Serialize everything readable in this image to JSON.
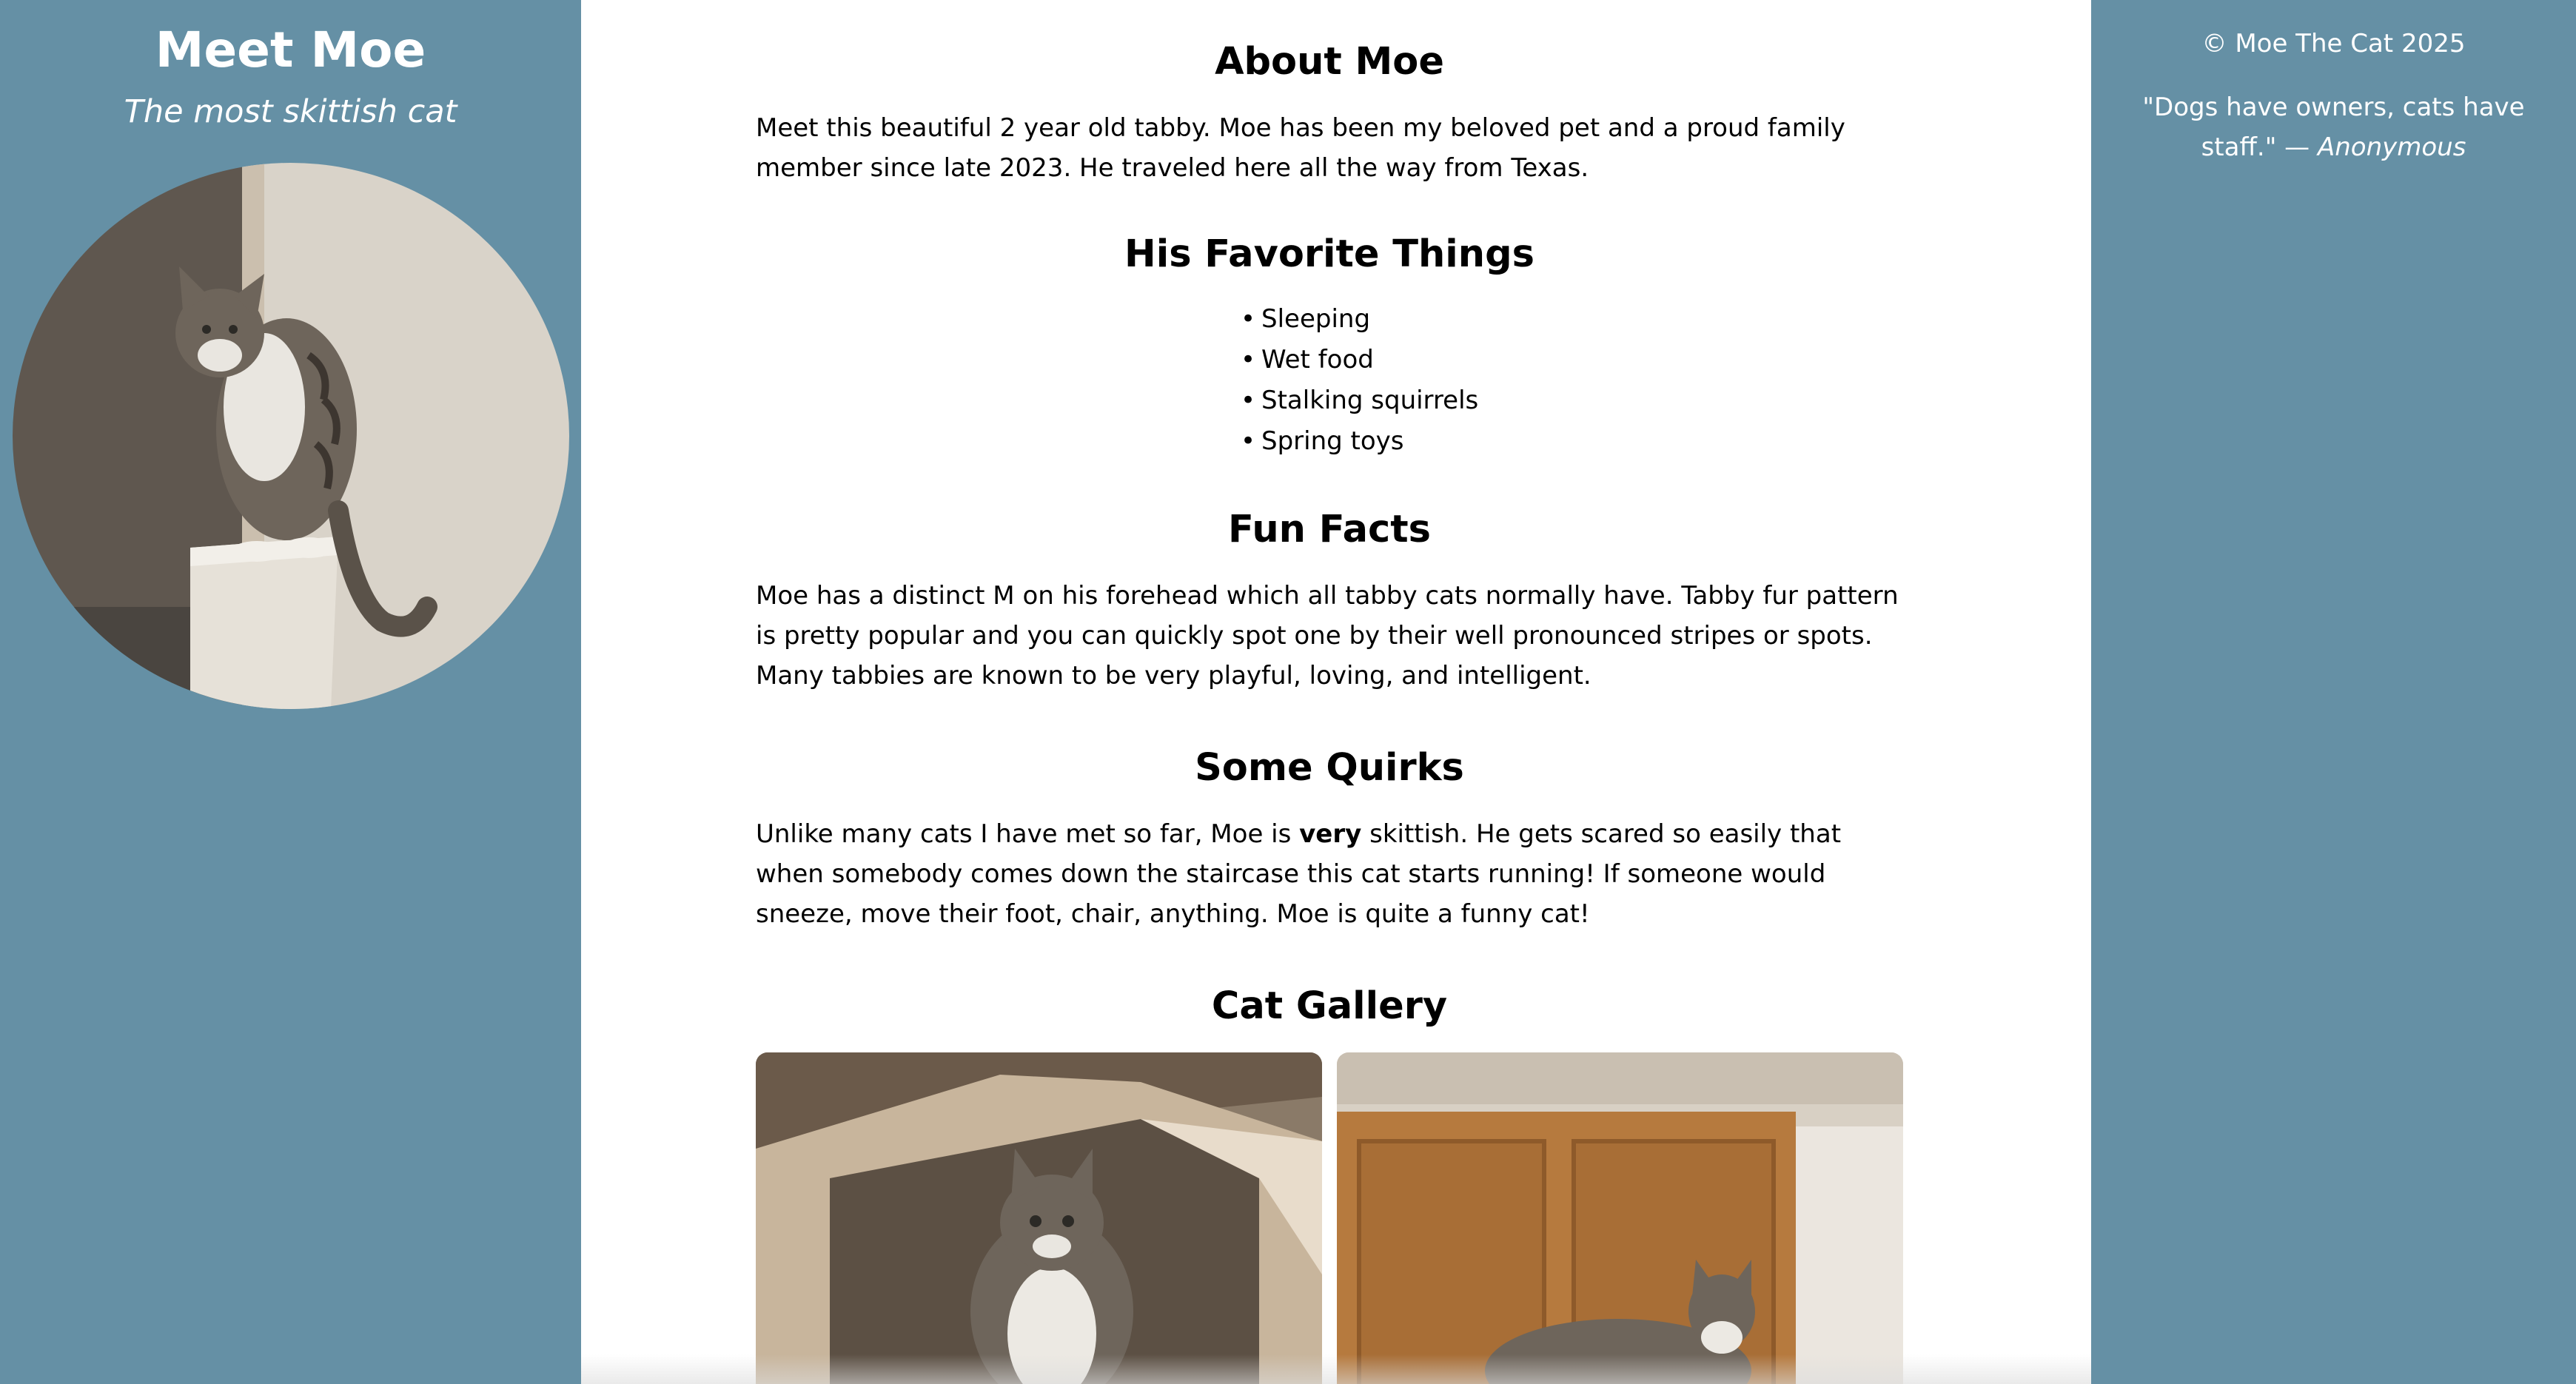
{
  "left_sidebar": {
    "title": "Meet Moe",
    "subtitle": "The most skittish cat"
  },
  "main": {
    "about": {
      "heading": "About Moe",
      "text": "Meet this beautiful 2 year old tabby. Moe has been my beloved pet and a proud family member since late 2023. He traveled here all the way from Texas."
    },
    "favorites": {
      "heading": "His Favorite Things",
      "items": [
        "Sleeping",
        "Wet food",
        "Stalking squirrels",
        "Spring toys"
      ]
    },
    "fun_facts": {
      "heading": "Fun Facts",
      "text": "Moe has a distinct M on his forehead which all tabby cats normally have. Tabby fur pattern is pretty popular and you can quickly spot one by their well pronounced stripes or spots. Many tabbies are known to be very playful, loving, and intelligent."
    },
    "quirks": {
      "heading": "Some Quirks",
      "text_before": "Unlike many cats I have met so far, Moe is ",
      "text_bold": "very",
      "text_after": " skittish. He gets scared so easily that when somebody comes down the staircase this cat starts running! If someone would sneeze, move their foot, chair, anything. Moe is quite a funny cat!"
    },
    "gallery": {
      "heading": "Cat Gallery"
    }
  },
  "right_sidebar": {
    "copyright": "© Moe The Cat 2025",
    "quote": "\"Dogs have owners, cats have staff.\" — ",
    "quote_author": "Anonymous"
  },
  "colors": {
    "sidebar_bg": "#6590a5",
    "main_bg": "#ffffff",
    "text": "#000000",
    "sidebar_text": "#ffffff"
  }
}
